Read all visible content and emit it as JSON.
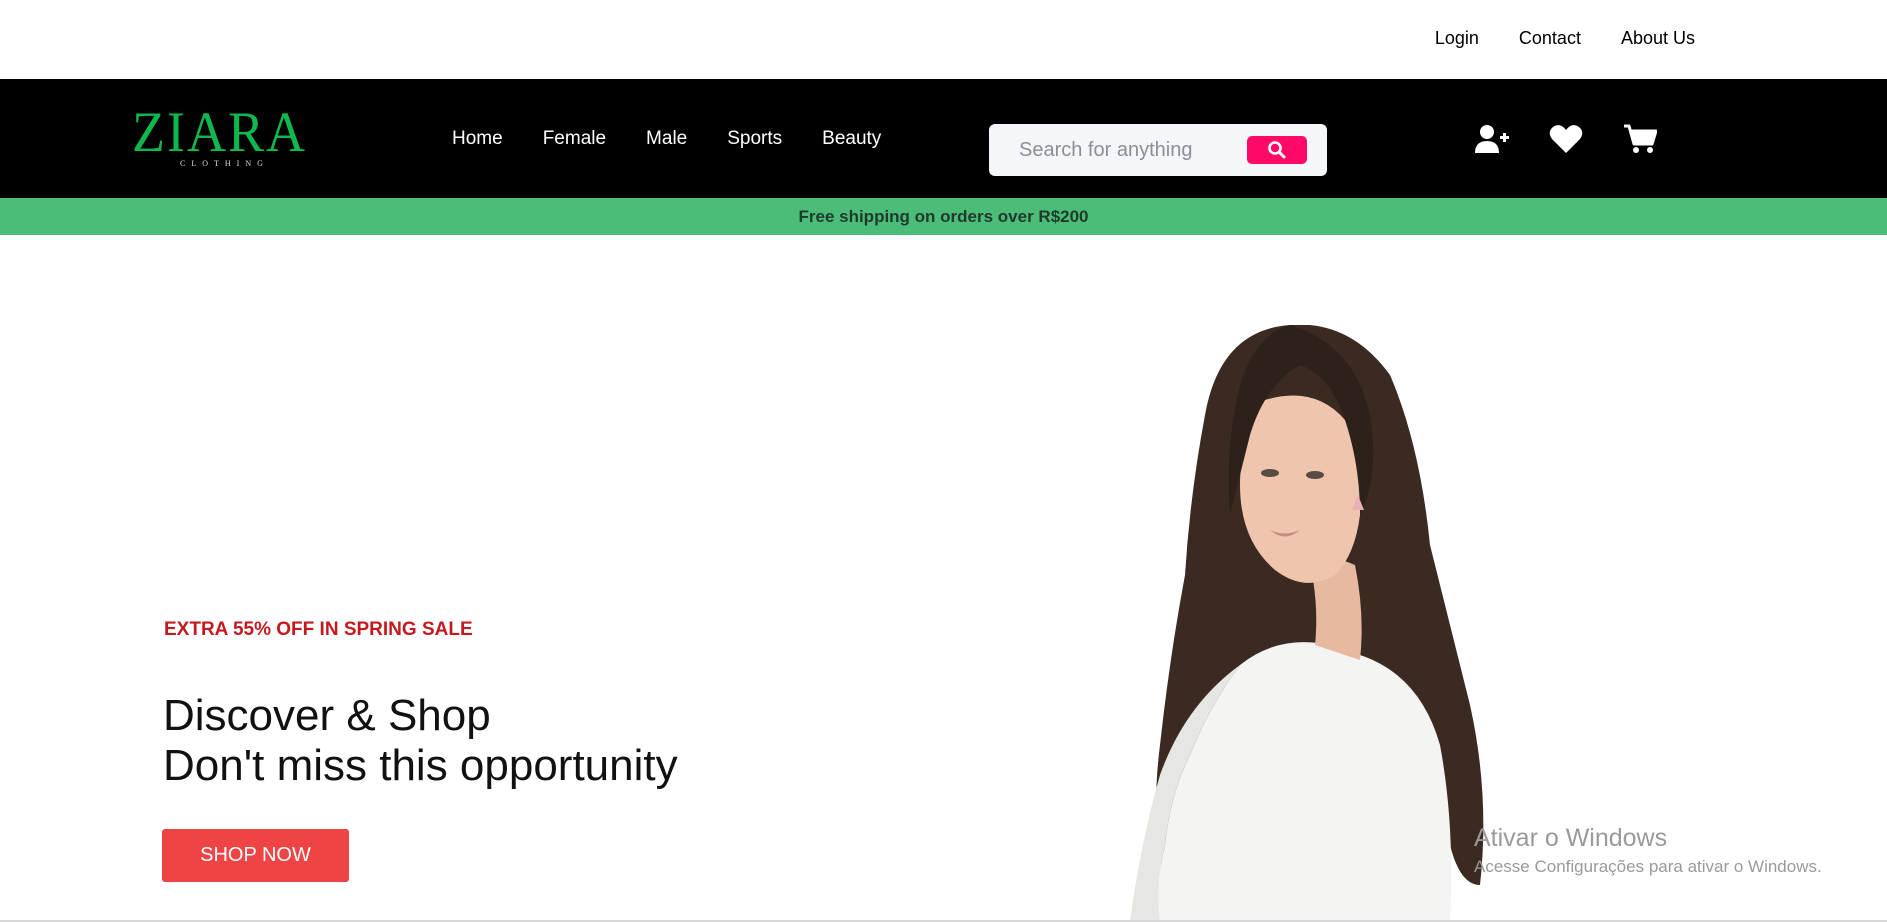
{
  "top_links": {
    "login": "Login",
    "contact": "Contact",
    "about": "About Us"
  },
  "brand": {
    "name": "ZIARA",
    "tagline": "CLOTHING",
    "logo_color": "#0fb84f"
  },
  "nav": {
    "home": "Home",
    "female": "Female",
    "male": "Male",
    "sports": "Sports",
    "beauty": "Beauty"
  },
  "search": {
    "placeholder": "Search for anything",
    "value": "",
    "button_color": "#ff0a66"
  },
  "header_icons": [
    "add-user-icon",
    "heart-icon",
    "cart-icon"
  ],
  "promo": {
    "text": "Free shipping on orders over R$200",
    "bg_color": "#4bbd78"
  },
  "hero": {
    "sale_tag": "EXTRA 55% OFF IN SPRING SALE",
    "title_line1": "Discover & Shop",
    "title_line2": "Don't miss this opportunity",
    "cta_label": "SHOP NOW",
    "cta_color": "#ef4444"
  },
  "watermark": {
    "title": "Ativar o Windows",
    "subtitle": "Acesse Configurações para ativar o Windows."
  }
}
